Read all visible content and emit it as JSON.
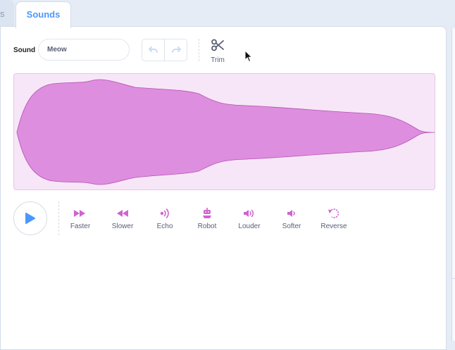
{
  "tabs": {
    "previous_partial": "s",
    "sounds": "Sounds"
  },
  "editor": {
    "sound_label": "Sound",
    "sound_name": "Meow",
    "trim_label": "Trim",
    "undo_icon": "undo-icon",
    "redo_icon": "redo-icon"
  },
  "effects": [
    {
      "label": "Faster",
      "icon": "faster-icon"
    },
    {
      "label": "Slower",
      "icon": "slower-icon"
    },
    {
      "label": "Echo",
      "icon": "echo-icon"
    },
    {
      "label": "Robot",
      "icon": "robot-icon"
    },
    {
      "label": "Louder",
      "icon": "louder-icon"
    },
    {
      "label": "Softer",
      "icon": "softer-icon"
    },
    {
      "label": "Reverse",
      "icon": "reverse-icon"
    }
  ],
  "colors": {
    "accent_blue": "#4c97ff",
    "effect_pink": "#cf63cf",
    "waveform_fill": "#de8ede",
    "waveform_bg": "#f7e6f7"
  }
}
